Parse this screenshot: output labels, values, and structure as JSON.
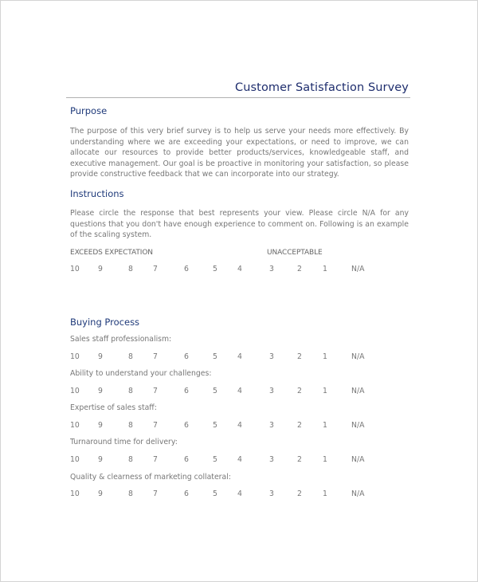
{
  "document": {
    "title": "Customer Satisfaction Survey",
    "purpose": {
      "heading": "Purpose",
      "text": "The purpose of this very brief survey is to help us serve your needs more effectively. By understanding where we are exceeding your expectations, or need to improve, we can allocate our resources to provide better products/services, knowledgeable staff, and executive management.  Our goal is be proactive in monitoring your satisfaction, so please provide constructive feedback that we can incorporate into our strategy."
    },
    "instructions": {
      "heading": "Instructions",
      "text": "Please circle the response that best represents your view.  Please circle N/A for any questions that you don't have enough experience to comment on.  Following is an example of the scaling system.",
      "scale_high_label": "EXCEEDS EXPECTATION",
      "scale_low_label": "UNACCEPTABLE"
    },
    "scale": [
      "10",
      "9",
      "8",
      "7",
      "6",
      "5",
      "4",
      "3",
      "2",
      "1",
      "N/A"
    ],
    "buying_process": {
      "heading": "Buying Process",
      "questions": [
        {
          "label": "Sales staff professionalism:"
        },
        {
          "label": "Ability to understand your challenges:"
        },
        {
          "label": "Expertise of sales staff:"
        },
        {
          "label": "Turnaround time for delivery:"
        },
        {
          "label": "Quality & clearness of marketing collateral:"
        }
      ]
    }
  }
}
